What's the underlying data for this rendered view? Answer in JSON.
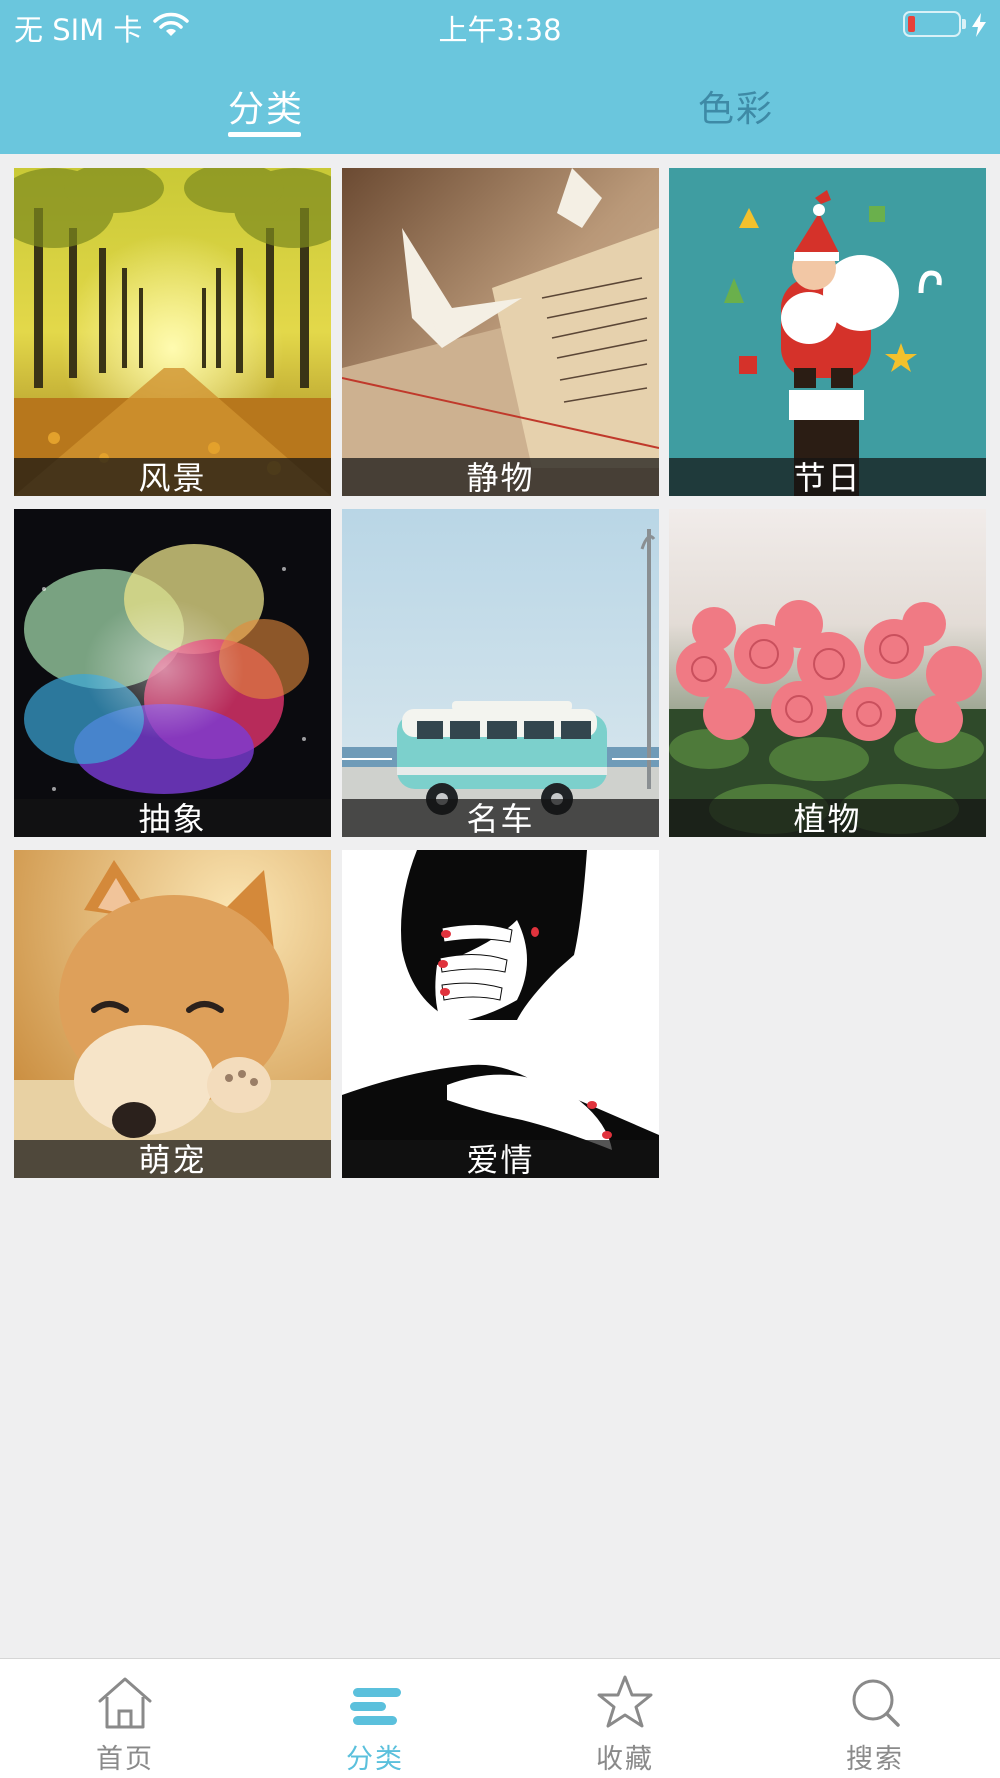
{
  "status_bar": {
    "carrier": "无 SIM 卡",
    "time": "上午3:38",
    "icons": [
      "wifi-icon",
      "battery-low-icon",
      "charging-bolt-icon"
    ]
  },
  "top_tabs": [
    {
      "label": "分类",
      "active": true
    },
    {
      "label": "色彩",
      "active": false
    }
  ],
  "categories": [
    {
      "label": "风景",
      "image": "autumn tree-lined avenue"
    },
    {
      "label": "静物",
      "image": "paper cranes on handwritten letter"
    },
    {
      "label": "节日",
      "image": "santa claus christmas illustration"
    },
    {
      "label": "抽象",
      "image": "colorful powder explosion"
    },
    {
      "label": "名车",
      "image": "teal vintage van by the sea"
    },
    {
      "label": "植物",
      "image": "pink roses bouquet"
    },
    {
      "label": "萌宠",
      "image": "shiba inu dog resting"
    },
    {
      "label": "爱情",
      "image": "black and white silhouette embrace"
    }
  ],
  "bottom_tabs": [
    {
      "label": "首页",
      "icon": "home-icon",
      "active": false
    },
    {
      "label": "分类",
      "icon": "category-list-icon",
      "active": true
    },
    {
      "label": "收藏",
      "icon": "star-icon",
      "active": false
    },
    {
      "label": "搜索",
      "icon": "search-icon",
      "active": false
    }
  ],
  "colors": {
    "header": "#6ac6dd",
    "active_tab": "#5bc0dc",
    "inactive_tab_text": "#3e8aa6",
    "background": "#efeff0"
  }
}
